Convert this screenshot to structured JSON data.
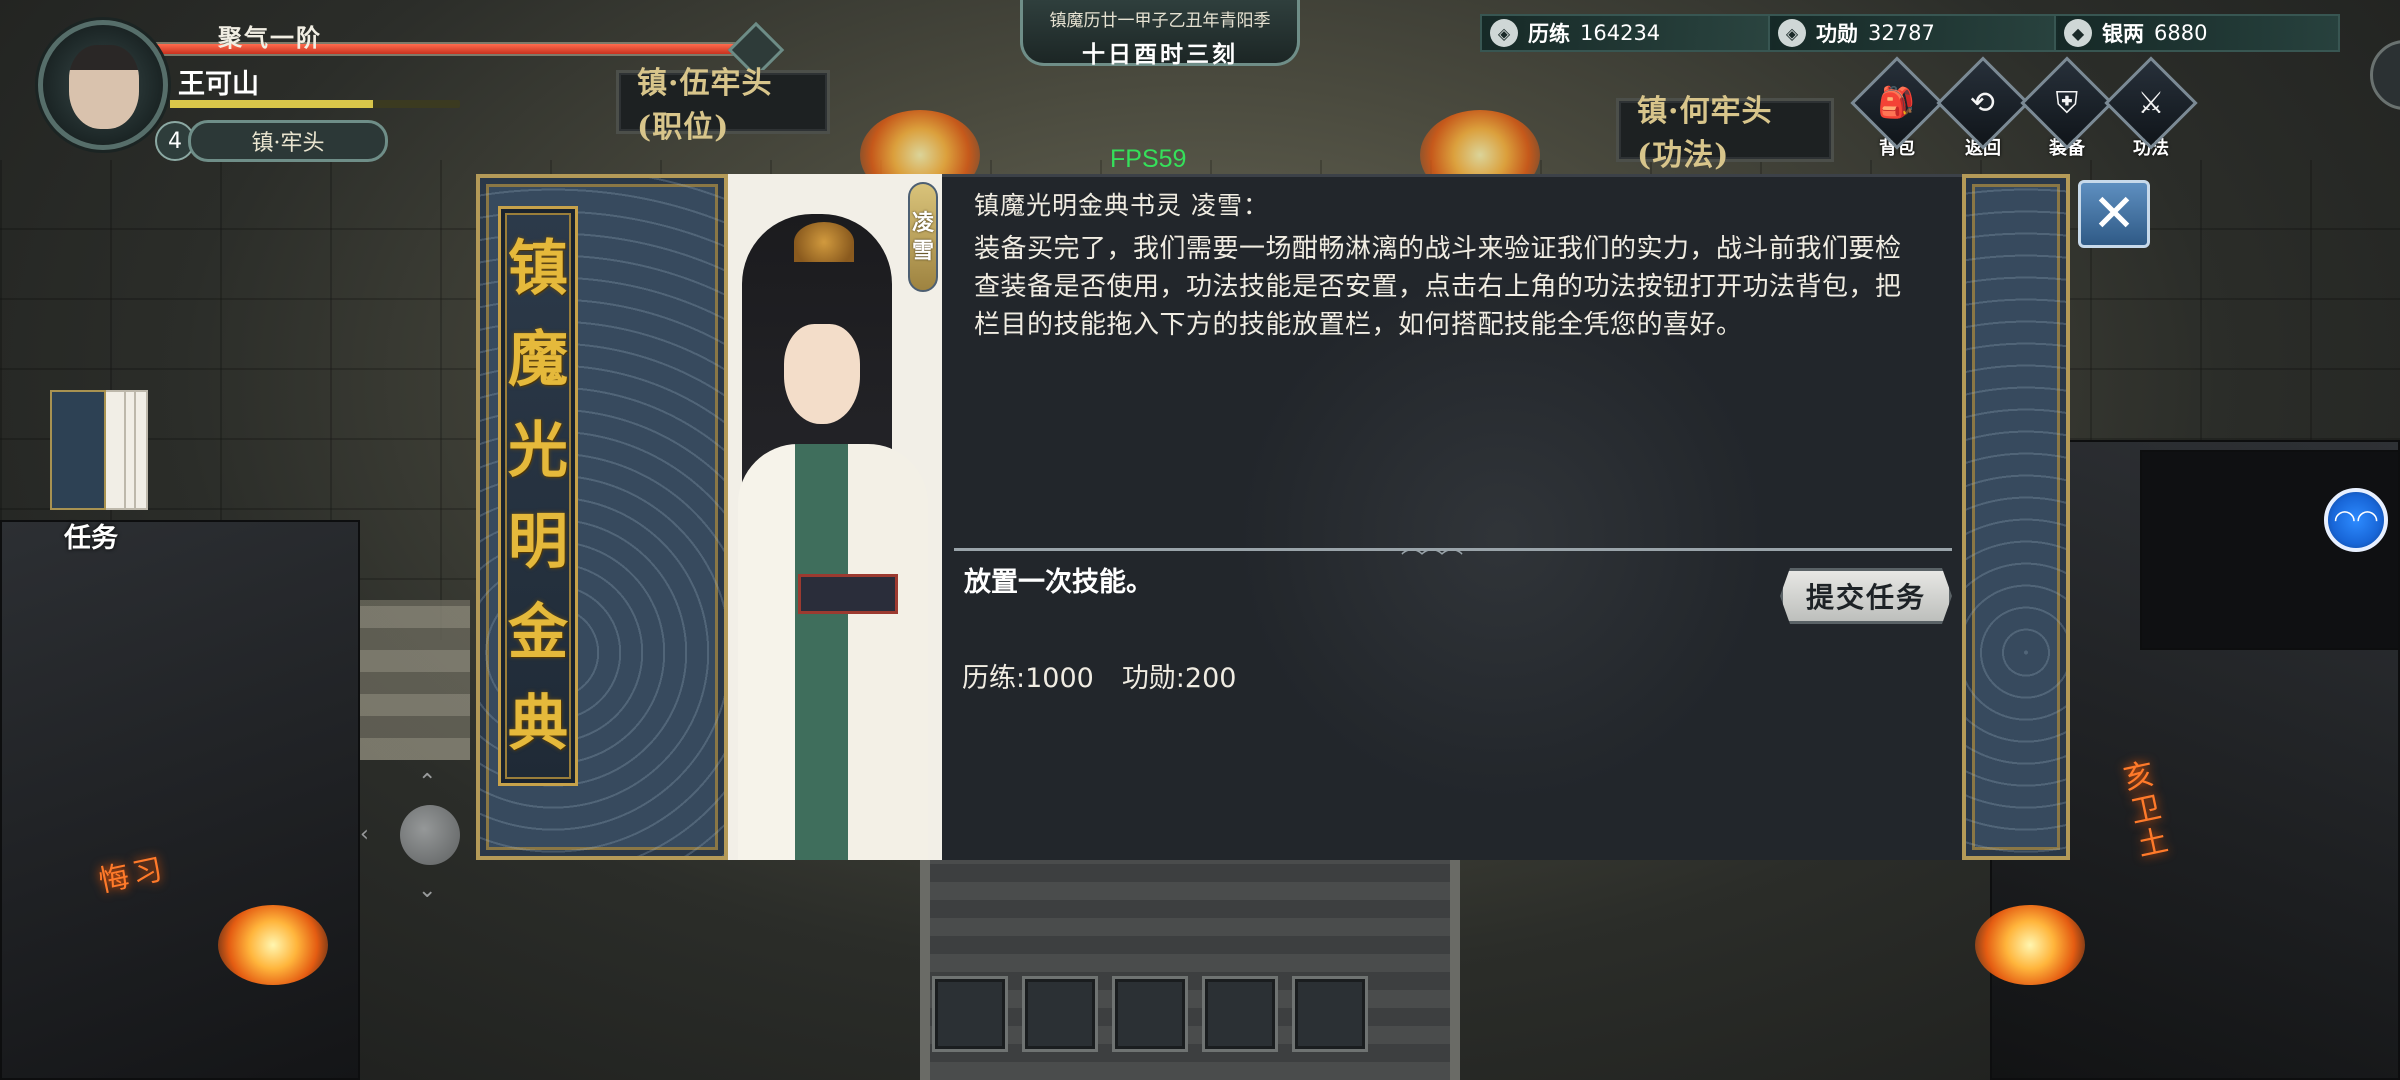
{
  "hud": {
    "realm": "聚气一阶",
    "player_name": "王可山",
    "level": "4",
    "rank_title": "镇·牢头",
    "hp_fraction": 0.98,
    "exp_fraction": 0.7
  },
  "banners": {
    "left": "镇·伍牢头(职位)",
    "right": "镇·何牢头(功法)"
  },
  "calendar": {
    "era_line": "镇魔历廿一甲子乙丑年青阳季",
    "time_line": "十日酉时三刻"
  },
  "fps": "FPS59",
  "resources": [
    {
      "icon": "shield-icon",
      "label": "历练",
      "value": "164234"
    },
    {
      "icon": "shield-icon",
      "label": "功勋",
      "value": "32787"
    },
    {
      "icon": "coin-icon",
      "label": "银两",
      "value": "6880"
    }
  ],
  "menu": [
    {
      "icon": "backpack-icon",
      "label": "背包"
    },
    {
      "icon": "return-icon",
      "label": "返回"
    },
    {
      "icon": "armor-icon",
      "label": "装备"
    },
    {
      "icon": "technique-icon",
      "label": "功法"
    }
  ],
  "task_tab": {
    "label": "任务"
  },
  "dialog": {
    "book_title_chars": [
      "镇",
      "魔",
      "光",
      "明",
      "金",
      "典"
    ],
    "npc_tag_chars": [
      "凌",
      "雪"
    ],
    "speaker": "镇魔光明金典书灵 凌雪：",
    "text": "装备买完了，我们需要一场酣畅淋漓的战斗来验证我们的实力，战斗前我们要检查装备是否使用，功法技能是否安置，点击右上角的功法按钮打开功法背包，把栏目的技能拖入下方的技能放置栏，如何搭配技能全凭您的喜好。",
    "objective": "放置一次技能。",
    "submit_label": "提交任务",
    "rewards": [
      "历练:1000",
      "功勋:200"
    ],
    "close_glyph": "✕"
  },
  "hotkey_slot_count": 5,
  "scene_glow_text": {
    "left": "悔习",
    "right": "亥卫土"
  }
}
